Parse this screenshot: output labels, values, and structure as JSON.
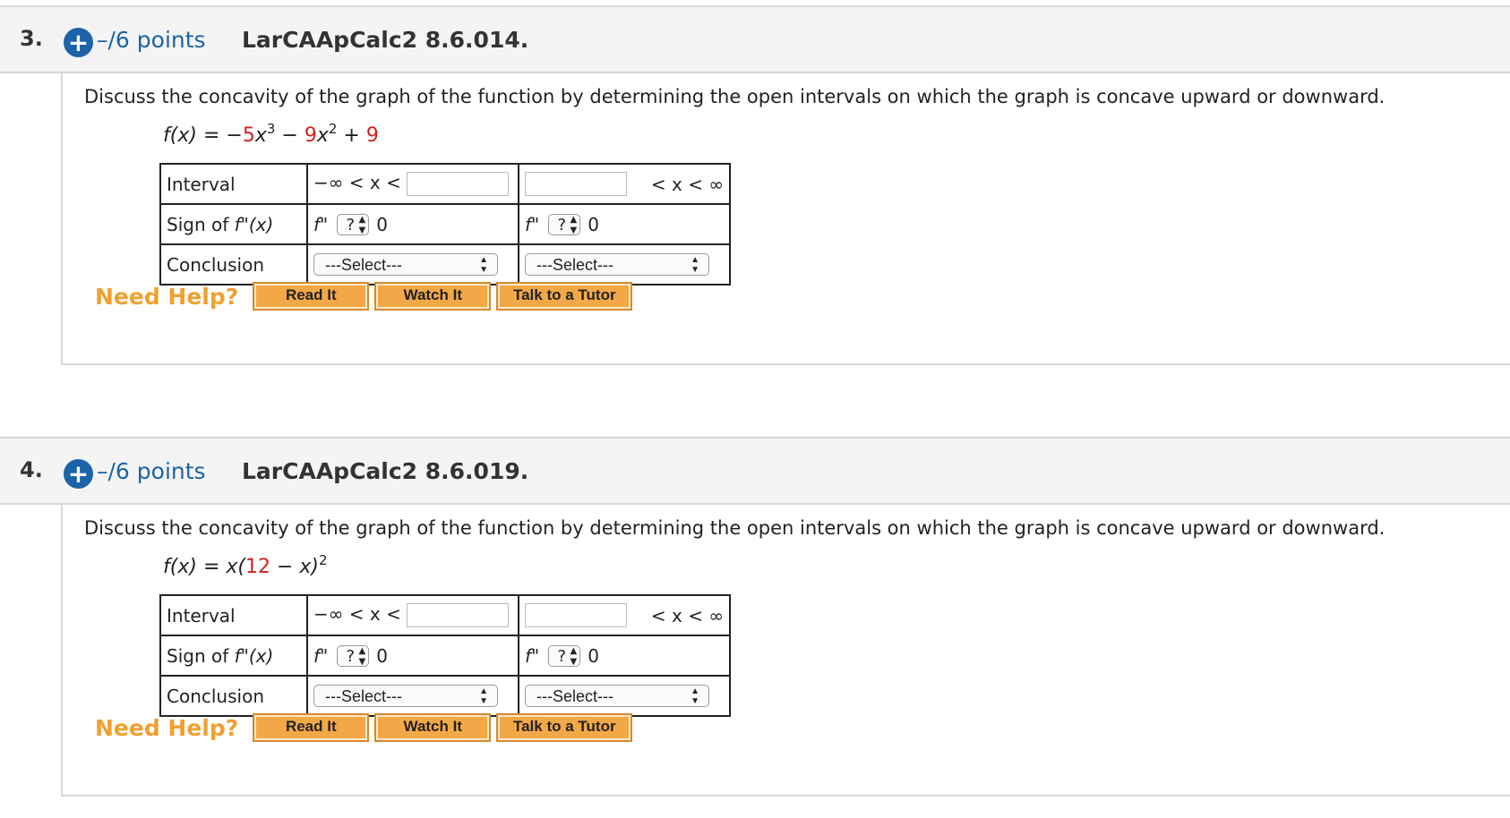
{
  "questions": [
    {
      "number": "3.",
      "plus": "+",
      "points": "–/6 points",
      "id": "LarCAApCalc2 8.6.014.",
      "prompt": "Discuss the concavity of the graph of the function by determining the open intervals on which the graph is concave upward or downward.",
      "function": {
        "lhs": "f(x)",
        "eq": "=",
        "parts": [
          "−",
          "5",
          "x",
          "3",
          " − ",
          "9",
          "x",
          "2",
          " + ",
          "9"
        ]
      },
      "table": {
        "row1_label": "Interval",
        "row2_label": "Sign of ",
        "row2_fx": "f\"(x)",
        "row3_label": "Conclusion",
        "left_interval": "−∞ < x <",
        "right_interval": "< x < ∞",
        "fpp": "f\"",
        "sign_select": "?",
        "zero": "0",
        "select_placeholder": "---Select---"
      },
      "help": {
        "label": "Need Help?",
        "read": "Read It",
        "watch": "Watch It",
        "tutor": "Talk to a Tutor"
      }
    },
    {
      "number": "4.",
      "plus": "+",
      "points": "–/6 points",
      "id": "LarCAApCalc2 8.6.019.",
      "prompt": "Discuss the concavity of the graph of the function by determining the open intervals on which the graph is concave upward or downward.",
      "function": {
        "lhs": "f(x)",
        "eq": "=",
        "parts": [
          "x(",
          "12",
          " − x)",
          "2"
        ]
      },
      "table": {
        "row1_label": "Interval",
        "row2_label": "Sign of ",
        "row2_fx": "f\"(x)",
        "row3_label": "Conclusion",
        "left_interval": "−∞ < x <",
        "right_interval": "< x < ∞",
        "fpp": "f\"",
        "sign_select": "?",
        "zero": "0",
        "select_placeholder": "---Select---"
      },
      "help": {
        "label": "Need Help?",
        "read": "Read It",
        "watch": "Watch It",
        "tutor": "Talk to a Tutor"
      }
    }
  ],
  "colors": {
    "blue": "#1c63a8",
    "red": "#cc2222",
    "orange": "#f0a030",
    "button": "#f3a847"
  }
}
